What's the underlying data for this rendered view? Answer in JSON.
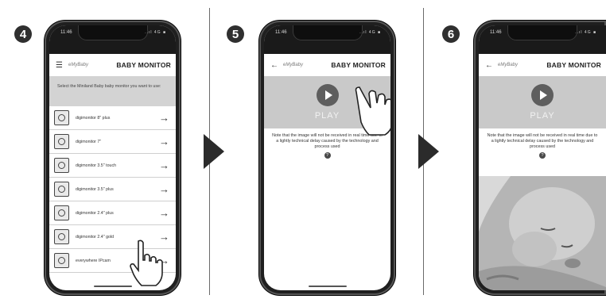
{
  "steps": [
    "4",
    "5",
    "6"
  ],
  "phone": {
    "time": "11:46",
    "sys_icons": "..ıl 4G ■"
  },
  "app": {
    "logo": "eMyBaby",
    "title": "BABY MONITOR"
  },
  "screen4": {
    "instruction": "Select the Miniland Baby baby monitor you want to use:",
    "devices": [
      "digimonitor 8\" plus",
      "digimonitor 7\"",
      "digimonitor 3.5\" touch",
      "digimonitor 3.5\" plus",
      "digimonitor 2.4\" plus",
      "digimonitor 2.4\" gold",
      "everywhere IPcam"
    ]
  },
  "player": {
    "play_label": "PLAY",
    "note": "Note that the image will not be received in real time due to a lightly technical delay caused by the technology and process used",
    "help": "?"
  },
  "icons": {
    "menu": "hamburger-icon",
    "back": "back-arrow-icon",
    "chevron": "chevron-right-icon",
    "hand": "hand-pointer-icon",
    "step_arrow": "triangle-right-icon"
  },
  "colors": {
    "badge": "#2f2f2f",
    "grey_band": "#d3d3d3",
    "arrow": "#2b2b2b"
  }
}
